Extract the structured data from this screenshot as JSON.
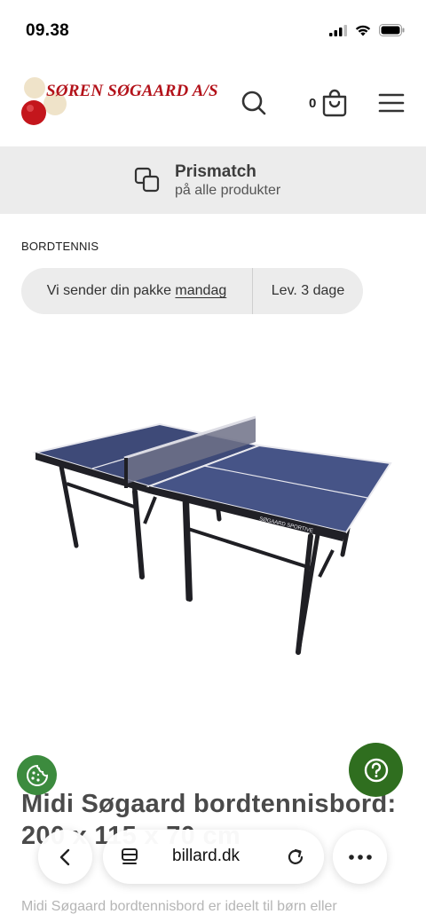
{
  "status_bar": {
    "time": "09.38"
  },
  "header": {
    "logo_text": "SØREN SØGAARD A/S",
    "cart_count": "0",
    "icons": {
      "search": "search-icon",
      "cart": "cart-icon",
      "menu": "menu-icon"
    }
  },
  "price_match": {
    "title": "Prismatch",
    "subtitle": "på alle produkter",
    "icon": "copy-icon"
  },
  "breadcrumb": "BORDTENNIS",
  "delivery": {
    "prefix": "Vi sender din pakke ",
    "day": "mandag",
    "lead_time": "Lev. 3 dage"
  },
  "product": {
    "title": "Midi Søgaard bordtennisbord: 200 x 115 x 70 cm",
    "description": "Midi Søgaard bordtennisbord er ideelt til børn eller",
    "table_brand": "SØGAARD SPORTIVE"
  },
  "browser": {
    "url": "billard.dk"
  },
  "colors": {
    "brand_red": "#b3121a",
    "help_green": "#2f6e1f",
    "cookie_green": "#3c8b3e",
    "banner_gray": "#ececec"
  }
}
